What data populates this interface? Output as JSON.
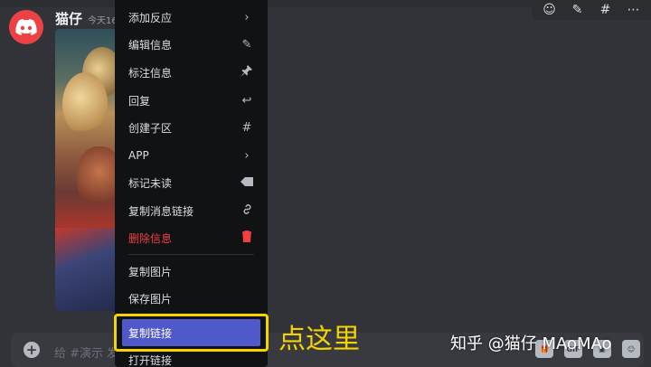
{
  "message": {
    "username": "猫仔",
    "timestamp": "今天16"
  },
  "menu": {
    "items": [
      {
        "label": "添加反应",
        "icon": "chevron-right-icon",
        "glyph": "›"
      },
      {
        "label": "编辑信息",
        "icon": "pencil-icon",
        "glyph": "✎"
      },
      {
        "label": "标注信息",
        "icon": "pin-icon",
        "glyph": "📌"
      },
      {
        "label": "回复",
        "icon": "reply-icon",
        "glyph": "↩"
      },
      {
        "label": "创建子区",
        "icon": "thread-icon",
        "glyph": "#"
      },
      {
        "label": "APP",
        "icon": "chevron-right-icon",
        "glyph": "›"
      },
      {
        "label": "标记未读",
        "icon": "mark-unread-icon",
        "glyph": "◀"
      },
      {
        "label": "复制消息链接",
        "icon": "link-icon",
        "glyph": "🔗"
      },
      {
        "label": "删除信息",
        "icon": "trash-icon",
        "glyph": "🗑"
      },
      {
        "label": "复制图片",
        "icon": "",
        "glyph": ""
      },
      {
        "label": "保存图片",
        "icon": "",
        "glyph": ""
      },
      {
        "label": "复制链接",
        "icon": "",
        "glyph": ""
      },
      {
        "label": "打开链接",
        "icon": "",
        "glyph": ""
      }
    ]
  },
  "callout": "点这里",
  "input": {
    "placeholder": "给 #演示 发"
  },
  "input_icons": {
    "gif": "GIF"
  },
  "watermark": "知乎 @猫仔 MAoMAo",
  "colors": {
    "background": "#313338",
    "menu_background": "#111214",
    "accent_active": "#5059c9",
    "danger": "#f23f43",
    "highlight": "#f5d300",
    "avatar": "#ed4245"
  }
}
